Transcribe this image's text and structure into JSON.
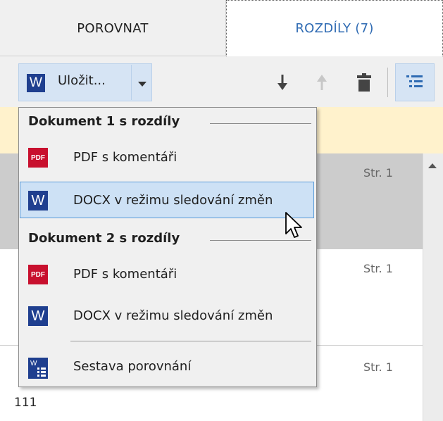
{
  "tabs": [
    {
      "label": "POROVNAT",
      "active": false
    },
    {
      "label": "ROZDÍLY (7)",
      "active": true
    }
  ],
  "toolbar": {
    "save_label": "Uložit...",
    "icons": [
      "word-icon",
      "chevron-down-icon",
      "arrow-down-icon",
      "arrow-up-icon",
      "trash-icon",
      "list-view-icon"
    ]
  },
  "menu": {
    "doc1_header": "Dokument 1 s rozdíly",
    "doc1_items": [
      {
        "label": "PDF s komentáři",
        "icon": "pdf-icon"
      },
      {
        "label": "DOCX v režimu sledování změn",
        "icon": "word-icon",
        "selected": true
      }
    ],
    "doc2_header": "Dokument 2 s rozdíly",
    "doc2_items": [
      {
        "label": "PDF s komentáři",
        "icon": "pdf-icon"
      },
      {
        "label": "DOCX v režimu sledování změn",
        "icon": "word-icon"
      }
    ],
    "report_item": {
      "label": "Sestava porovnání",
      "icon": "report-icon"
    }
  },
  "list": {
    "page_refs": [
      "Str. 1",
      "Str. 1",
      "Str. 1"
    ],
    "row_text": "111"
  },
  "colors": {
    "accent": "#2f6bb3",
    "word_blue": "#1f3f8f",
    "pdf_red": "#c8102e",
    "highlight_yellow": "#fff2cc",
    "selection_blue": "#cde1f5"
  }
}
